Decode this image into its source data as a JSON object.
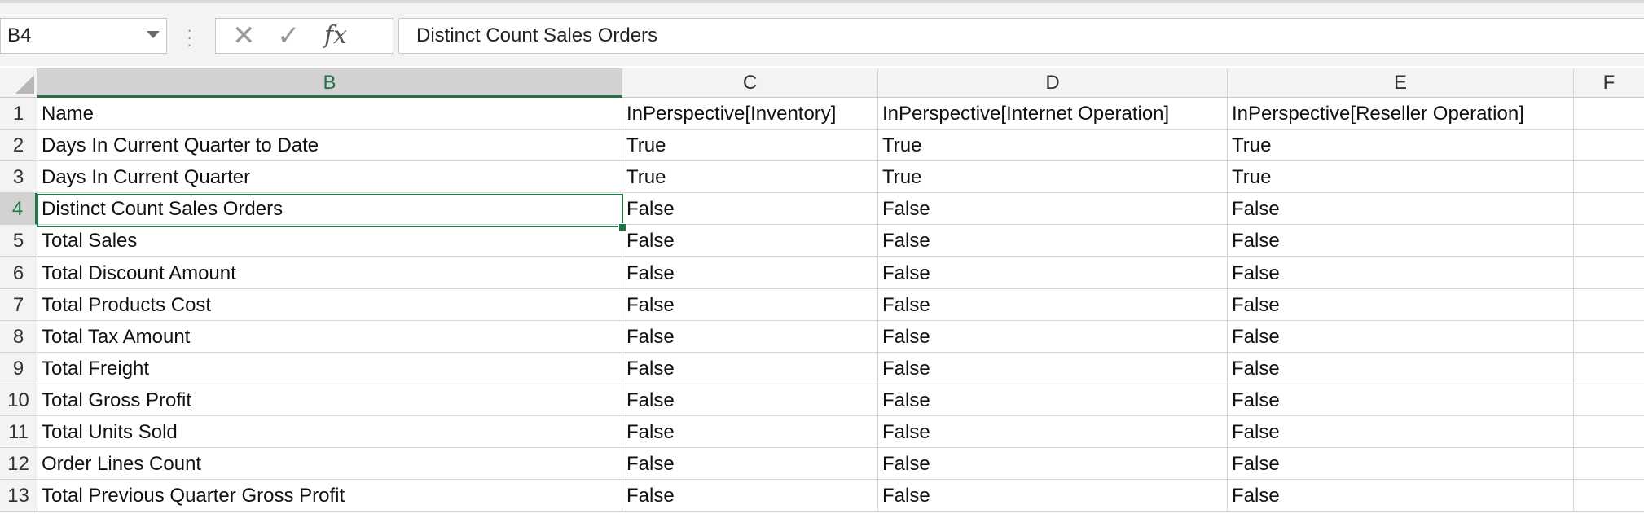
{
  "name_box": {
    "value": "B4"
  },
  "formula_bar": {
    "cancel_icon": "close-icon",
    "enter_icon": "check-icon",
    "function_icon": "fx-icon",
    "content": "Distinct Count Sales Orders"
  },
  "columns": [
    "B",
    "C",
    "D",
    "E",
    "F"
  ],
  "active_cell": {
    "column": "B",
    "row": "4"
  },
  "rows": [
    {
      "num": "1",
      "cells": [
        "Name",
        "InPerspective[Inventory]",
        "InPerspective[Internet Operation]",
        "InPerspective[Reseller Operation]",
        ""
      ]
    },
    {
      "num": "2",
      "cells": [
        "Days In Current Quarter to Date",
        "True",
        "True",
        "True",
        ""
      ]
    },
    {
      "num": "3",
      "cells": [
        "Days In Current Quarter",
        "True",
        "True",
        "True",
        ""
      ]
    },
    {
      "num": "4",
      "cells": [
        "Distinct Count Sales Orders",
        "False",
        "False",
        "False",
        ""
      ]
    },
    {
      "num": "5",
      "cells": [
        "Total Sales",
        "False",
        "False",
        "False",
        ""
      ]
    },
    {
      "num": "6",
      "cells": [
        "Total Discount Amount",
        "False",
        "False",
        "False",
        ""
      ]
    },
    {
      "num": "7",
      "cells": [
        "Total Products Cost",
        "False",
        "False",
        "False",
        ""
      ]
    },
    {
      "num": "8",
      "cells": [
        "Total Tax Amount",
        "False",
        "False",
        "False",
        ""
      ]
    },
    {
      "num": "9",
      "cells": [
        "Total Freight",
        "False",
        "False",
        "False",
        ""
      ]
    },
    {
      "num": "10",
      "cells": [
        "Total Gross Profit",
        "False",
        "False",
        "False",
        ""
      ]
    },
    {
      "num": "11",
      "cells": [
        "Total Units Sold",
        "False",
        "False",
        "False",
        ""
      ]
    },
    {
      "num": "12",
      "cells": [
        "Order Lines Count",
        "False",
        "False",
        "False",
        ""
      ]
    },
    {
      "num": "13",
      "cells": [
        "Total Previous Quarter Gross Profit",
        "False",
        "False",
        "False",
        ""
      ]
    }
  ],
  "colors": {
    "accent": "#217346",
    "header_bg": "#f3f3f3",
    "active_header_bg": "#d2d2d2",
    "gridline": "#d4d4d4"
  }
}
